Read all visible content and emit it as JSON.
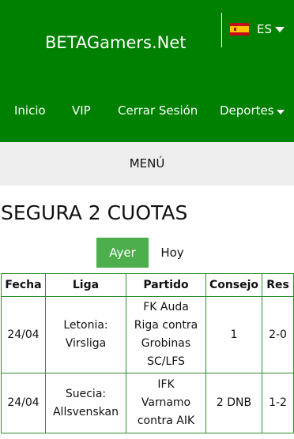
{
  "header": {
    "brand": "BETAGamers.Net",
    "language": {
      "code": "ES",
      "icon": "spain-flag-icon"
    }
  },
  "nav": {
    "items": [
      "Inicio",
      "VIP",
      "Cerrar Sesión",
      "Deportes"
    ]
  },
  "menu_bar": {
    "label": "MENÚ"
  },
  "main": {
    "title": "SEGURA 2 CUOTAS",
    "tabs": [
      {
        "label": "Ayer",
        "active": true
      },
      {
        "label": "Hoy",
        "active": false
      }
    ],
    "table": {
      "headers": [
        "Fecha",
        "Liga",
        "Partido",
        "Consejo",
        "Res"
      ],
      "rows": [
        {
          "fecha": "24/04",
          "liga": [
            "Letonia:",
            "Virsliga"
          ],
          "partido": [
            "FK Auda",
            "Riga contra",
            "Grobinas",
            "SC/LFS"
          ],
          "consejo": "1",
          "res": "2-0"
        },
        {
          "fecha": "24/04",
          "liga": [
            "Suecia:",
            "Allsvenskan"
          ],
          "partido": [
            "IFK",
            "Varnamo",
            "contra AIK"
          ],
          "consejo": "2 DNB",
          "res": "1-2"
        }
      ]
    }
  },
  "colors": {
    "header_bg": "#008000",
    "active_tab": "#4cae4c",
    "menu_bg": "#eeeeee",
    "table_border": "#2e8b2e"
  }
}
